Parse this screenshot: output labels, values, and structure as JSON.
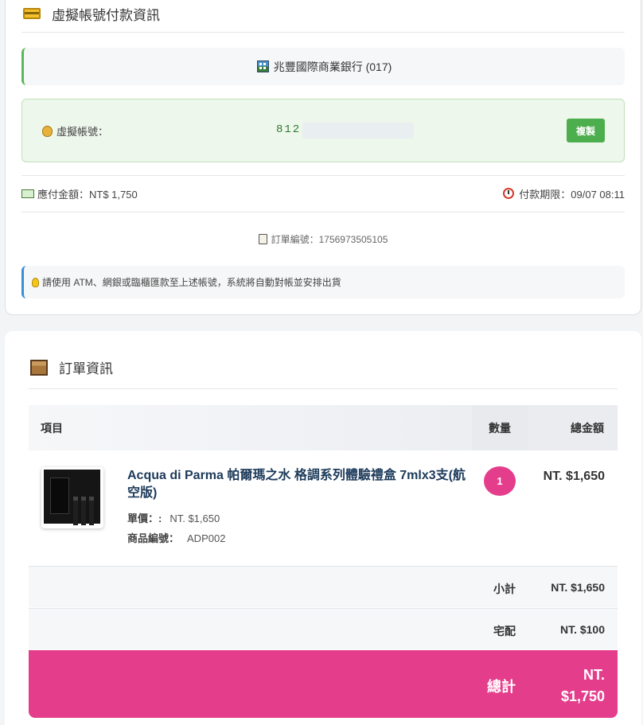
{
  "virtual_account": {
    "title": "虛擬帳號付款資訊",
    "bank": "兆豐國際商業銀行 (017)",
    "account_label": "虛擬帳號：",
    "account_number": "812",
    "copy_button": "複製",
    "amount": "應付金額：NT$ 1,750",
    "deadline": "付款期限：09/07 08:11",
    "order_number": "訂單編號：1756973505105",
    "notice": "請使用 ATM、網銀或臨櫃匯款至上述帳號，系統將自動對帳並安排出貨"
  },
  "order": {
    "title": "訂單資訊",
    "headers": {
      "item": "項目",
      "qty": "數量",
      "total": "總金額"
    },
    "product": {
      "name": "Acqua di Parma 帕爾瑪之水 格調系列體驗禮盒 7mlx3支(航空版)",
      "unit_price_label": "單價：:",
      "unit_price": "NT. $1,650",
      "sku_label": "商品編號：",
      "sku": "ADP002",
      "qty": "1",
      "total": "NT. $1,650"
    },
    "subtotal": {
      "label": "小計",
      "value": "NT. $1,650"
    },
    "shipping": {
      "label": "宅配",
      "value": "NT. $100"
    },
    "grand_total": {
      "label": "總計",
      "value": "NT. $1,750"
    }
  },
  "colors": {
    "accent": "#e43d8c",
    "success": "#4cae4c",
    "info": "#3b8fd6"
  }
}
